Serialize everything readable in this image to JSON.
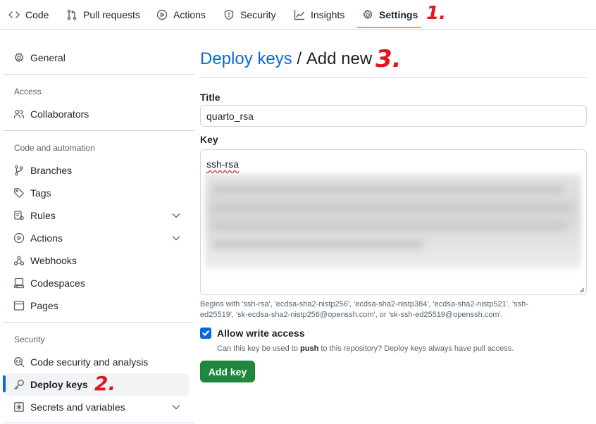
{
  "topnav": {
    "tabs": [
      {
        "label": "Code",
        "icon": "code-icon"
      },
      {
        "label": "Pull requests",
        "icon": "pull-request-icon"
      },
      {
        "label": "Actions",
        "icon": "play-icon"
      },
      {
        "label": "Security",
        "icon": "shield-icon"
      },
      {
        "label": "Insights",
        "icon": "graph-icon"
      },
      {
        "label": "Settings",
        "icon": "gear-icon",
        "selected": true
      }
    ]
  },
  "annotations": [
    "1.",
    "2.",
    "3."
  ],
  "sidebar": {
    "general": "General",
    "sections": [
      {
        "heading": "Access",
        "items": [
          {
            "label": "Collaborators",
            "icon": "people-icon"
          }
        ]
      },
      {
        "heading": "Code and automation",
        "items": [
          {
            "label": "Branches",
            "icon": "branch-icon"
          },
          {
            "label": "Tags",
            "icon": "tag-icon"
          },
          {
            "label": "Rules",
            "icon": "rules-icon",
            "expandable": true
          },
          {
            "label": "Actions",
            "icon": "play-icon",
            "expandable": true
          },
          {
            "label": "Webhooks",
            "icon": "webhook-icon"
          },
          {
            "label": "Codespaces",
            "icon": "codespaces-icon"
          },
          {
            "label": "Pages",
            "icon": "browser-icon"
          }
        ]
      },
      {
        "heading": "Security",
        "items": [
          {
            "label": "Code security and analysis",
            "icon": "codescan-icon"
          },
          {
            "label": "Deploy keys",
            "icon": "key-icon",
            "active": true
          },
          {
            "label": "Secrets and variables",
            "icon": "asterisk-icon",
            "expandable": true
          }
        ]
      }
    ]
  },
  "main": {
    "heading_link": "Deploy keys",
    "heading_separator": " / ",
    "heading_current": "Add new",
    "title_label": "Title",
    "title_value": "quarto_rsa",
    "key_label": "Key",
    "key_value": "ssh-rsa",
    "key_hint": "Begins with 'ssh-rsa', 'ecdsa-sha2-nistp256', 'ecdsa-sha2-nistp384', 'ecdsa-sha2-nistp521', 'ssh-ed25519', 'sk-ecdsa-sha2-nistp256@openssh.com', or 'sk-ssh-ed25519@openssh.com'.",
    "write_access_label": "Allow write access",
    "write_access_checked": true,
    "write_help_before": "Can this key be used to ",
    "write_help_bold": "push",
    "write_help_after": " to this repository? Deploy keys always have pull access.",
    "add_button": "Add key"
  },
  "colors": {
    "accent": "#0969da",
    "primary_button": "#1f883d",
    "tab_underline": "#fd8c73",
    "annotation": "#e5141d"
  }
}
